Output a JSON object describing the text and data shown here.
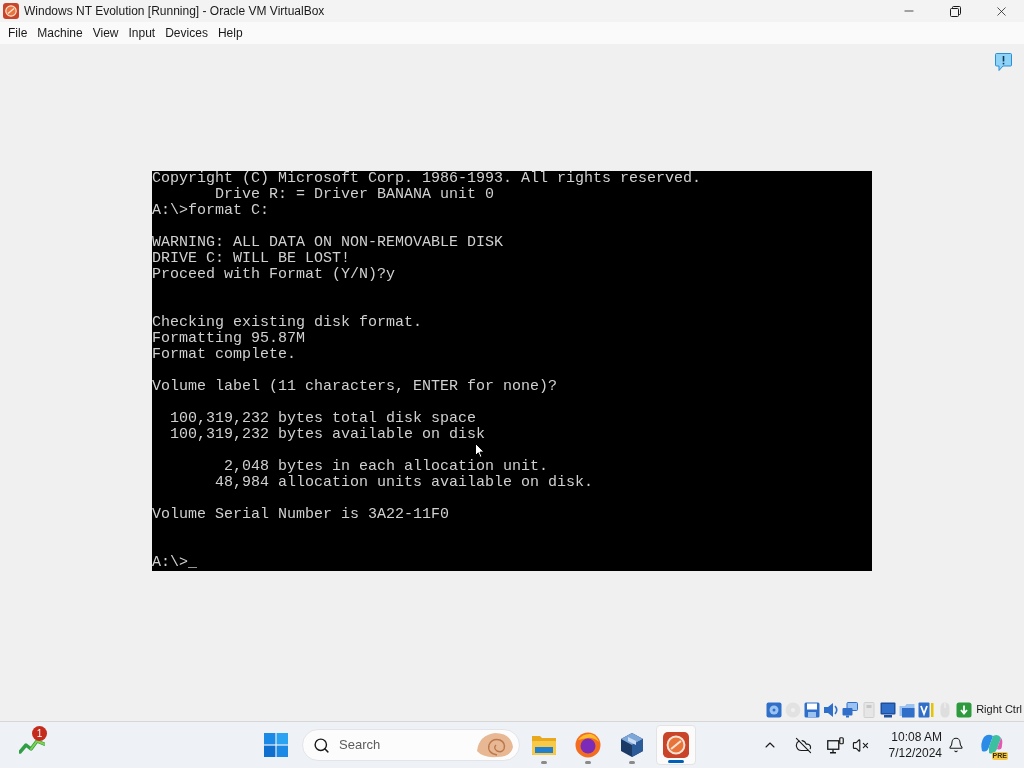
{
  "window": {
    "title": "Windows NT Evolution [Running] - Oracle VM VirtualBox"
  },
  "menu": [
    "File",
    "Machine",
    "View",
    "Input",
    "Devices",
    "Help"
  ],
  "console": {
    "lines": [
      {
        "kind": "text",
        "text": "Copyright (C) Microsoft Corp. 1986-1993. All rights reserved."
      },
      {
        "kind": "text",
        "text": "       Drive R: = Driver BANANA unit 0"
      },
      {
        "kind": "text",
        "text": "A:\\>format C:"
      },
      {
        "kind": "blank"
      },
      {
        "kind": "text",
        "text": "WARNING: ALL DATA ON NON-REMOVABLE DISK"
      },
      {
        "kind": "text",
        "text": "DRIVE C: WILL BE LOST!"
      },
      {
        "kind": "text",
        "text": "Proceed with Format (Y/N)?y"
      },
      {
        "kind": "blank"
      },
      {
        "kind": "blank"
      },
      {
        "kind": "text",
        "text": "Checking existing disk format."
      },
      {
        "kind": "text",
        "text": "Formatting 95.87M"
      },
      {
        "kind": "text",
        "text": "Format complete."
      },
      {
        "kind": "blank"
      },
      {
        "kind": "text",
        "text": "Volume label (11 characters, ENTER for none)?"
      },
      {
        "kind": "blank"
      },
      {
        "kind": "text",
        "text": "  100,319,232 bytes total disk space"
      },
      {
        "kind": "text",
        "text": "  100,319,232 bytes available on disk"
      },
      {
        "kind": "blank"
      },
      {
        "kind": "text",
        "text": "        2,048 bytes in each allocation unit."
      },
      {
        "kind": "text",
        "text": "       48,984 allocation units available on disk."
      },
      {
        "kind": "blank"
      },
      {
        "kind": "text",
        "text": "Volume Serial Number is 3A22-11F0"
      },
      {
        "kind": "blank"
      },
      {
        "kind": "blank"
      },
      {
        "kind": "text",
        "text": "A:\\>_"
      }
    ]
  },
  "status_bar": {
    "indicators": [
      {
        "kind": "hard-disk",
        "active": true
      },
      {
        "kind": "optical-disc",
        "active": false
      },
      {
        "kind": "floppy",
        "active": true
      },
      {
        "kind": "audio",
        "active": true
      },
      {
        "kind": "network",
        "active": true
      },
      {
        "kind": "usb",
        "active": false
      },
      {
        "kind": "display",
        "active": true
      },
      {
        "kind": "shared-folder",
        "active": true
      },
      {
        "kind": "capture",
        "active": true
      },
      {
        "kind": "mouse",
        "active": false
      },
      {
        "kind": "keyboard",
        "active": true
      }
    ],
    "host_key": "Right Ctrl"
  },
  "taskbar": {
    "widgets": {
      "badge": "1"
    },
    "search": {
      "placeholder": "Search"
    },
    "apps": [
      {
        "kind": "file-explorer",
        "running": true,
        "selected": false
      },
      {
        "kind": "browser",
        "running": true,
        "selected": false
      },
      {
        "kind": "virtualbox",
        "running": true,
        "selected": false
      },
      {
        "kind": "vm",
        "running": true,
        "selected": true
      }
    ],
    "clock": {
      "time": "10:08 AM",
      "date": "7/12/2024"
    },
    "corner_app": {
      "badge": "PRE"
    }
  }
}
